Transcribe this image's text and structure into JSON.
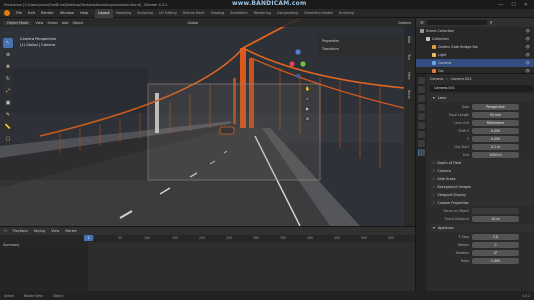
{
  "window": {
    "title": "Production [C:\\Users\\xxxx\\OneDrive\\Desktop\\Youtube\\tutorials\\production.blend] - Blender 4.3.2",
    "watermark": "www.BANDICAM.com",
    "controls": [
      "—",
      "☐",
      "✕"
    ]
  },
  "menu": {
    "items": [
      "File",
      "Edit",
      "Render",
      "Window",
      "Help"
    ],
    "workspaces": [
      "Layout",
      "Modeling",
      "Sculpting",
      "UV Editing",
      "Texture Paint",
      "Shading",
      "Animation",
      "Rendering",
      "Compositing",
      "Geometry Nodes",
      "Scripting"
    ],
    "active_workspace": "Layout"
  },
  "viewport": {
    "header": {
      "mode": "Object Mode",
      "items": [
        "View",
        "Select",
        "Add",
        "Object"
      ],
      "transform": "Global",
      "options": "Options"
    },
    "camera_info": [
      "Camera Perspective",
      "(1) Global | Camera"
    ],
    "tools": [
      "cursor",
      "move",
      "rotate",
      "scale",
      "transform",
      "annotate",
      "measure",
      "add"
    ],
    "nav_buttons": [
      "✋",
      "🔍",
      "🎥",
      "⊞"
    ],
    "side_panel": {
      "rows": [
        "Properties",
        "Transform"
      ]
    },
    "n_tabs": [
      "Item",
      "Tool",
      "View",
      "Bevel"
    ],
    "colors": {
      "sky": "#2e3138",
      "bridge": "#d85a1c",
      "road": "#3c3c3e",
      "camera_frame": "#7a6e66"
    }
  },
  "timeline": {
    "header": [
      "Playback",
      "Keying",
      "View",
      "Marker"
    ],
    "ruler": [
      "0",
      "50",
      "100",
      "150",
      "200",
      "250",
      "300",
      "350",
      "400",
      "450",
      "500",
      "550",
      "600"
    ],
    "current_frame": "1",
    "summary": "Summary"
  },
  "statusbar": {
    "items": [
      "Select",
      "Rotate View",
      "Object"
    ],
    "version": "4.3.2"
  },
  "outliner": {
    "search_placeholder": "",
    "rows": [
      {
        "label": "Scene Collection",
        "depth": 0,
        "color": "#9a9a9a",
        "selected": false
      },
      {
        "label": "Collection",
        "depth": 1,
        "color": "#c8c8c8",
        "selected": false
      },
      {
        "label": "Golden Gate Bridge.fbx",
        "depth": 2,
        "color": "#e0a040",
        "selected": false
      },
      {
        "label": "Light",
        "depth": 2,
        "color": "#e8c060",
        "selected": false
      },
      {
        "label": "Camera",
        "depth": 2,
        "color": "#67a7e0",
        "selected": true
      },
      {
        "label": "Car",
        "depth": 2,
        "color": "#e07a3a",
        "selected": false
      }
    ]
  },
  "properties": {
    "breadcrumb": [
      "Camera",
      "Camera.001"
    ],
    "data_name": "Camera.001",
    "sections": {
      "lens": {
        "title": "Lens",
        "rows": [
          {
            "label": "Type",
            "value": "Perspective"
          },
          {
            "label": "Focal Length",
            "value": "50 mm"
          },
          {
            "label": "Lens Unit",
            "value": "Millimeters"
          },
          {
            "label": "Shift X",
            "value": "0.000"
          },
          {
            "label": "Y",
            "value": "0.000"
          },
          {
            "label": "Clip Start",
            "value": "0.1 m"
          },
          {
            "label": "End",
            "value": "1000 m"
          }
        ]
      },
      "collapsed": [
        "Depth of Field",
        "Camera",
        "Safe Areas",
        "Background Images",
        "Viewport Display",
        "Custom Properties"
      ],
      "dof": {
        "rows": [
          {
            "label": "Focus on Object",
            "value": ""
          },
          {
            "label": "Focus Distance",
            "value": "10 m"
          }
        ],
        "aperture_title": "Aperture",
        "aperture_rows": [
          {
            "label": "F-Stop",
            "value": "2.8"
          },
          {
            "label": "Blades",
            "value": "0"
          },
          {
            "label": "Rotation",
            "value": "0°"
          },
          {
            "label": "Ratio",
            "value": "1.000"
          }
        ]
      }
    }
  }
}
